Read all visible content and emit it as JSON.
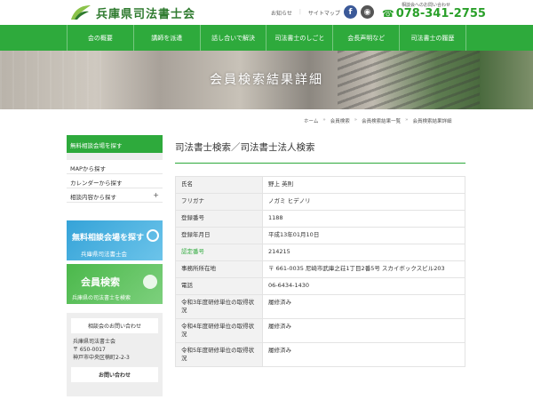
{
  "header": {
    "logo_text": "兵庫県司法書士会",
    "toplinks": [
      "お知らせ",
      "サイトマップ"
    ],
    "sns": [
      "f",
      "◉"
    ],
    "phone_note": "相談会へのお問い合わせ",
    "phone_number": "078-341-2755"
  },
  "nav": {
    "items": [
      "会の概要",
      "講師を派遣",
      "話し合いで解決",
      "司法書士のしごと",
      "会長声明など",
      "司法書士の履歴"
    ]
  },
  "hero": {
    "title": "会員検索結果詳細"
  },
  "breadcrumb": [
    "ホーム",
    "会員検索",
    "会員検索結果一覧",
    "会員検索結果詳細"
  ],
  "sidebar": {
    "head": "無料相談会場を探す",
    "items": [
      "MAPから探す",
      "カレンダーから探す",
      "相談内容から探す"
    ],
    "banner1": {
      "main": "無料相談会場を探す",
      "sub": "兵庫県司法書士会"
    },
    "banner2": {
      "main": "会員検索",
      "sub": "兵庫県の司法書士を検索"
    },
    "contact": {
      "title": "相談会のお問い合わせ",
      "lines": [
        "兵庫県司法書士会",
        "〒 650-0017",
        "神戸市中央区楠町2-2-3"
      ],
      "button": "お問い合わせ"
    }
  },
  "main": {
    "title": "司法書士検索／司法書士法人検索",
    "rows": [
      {
        "key": "氏名",
        "value": "野上 英則"
      },
      {
        "key": "フリガナ",
        "value": "ノガミ ヒデノリ"
      },
      {
        "key": "登録番号",
        "value": "1188"
      },
      {
        "key": "登録年月日",
        "value": "平成13年01月10日"
      },
      {
        "key": "認定番号",
        "value": "214215"
      },
      {
        "key": "事務所所在地",
        "value": "〒 661-0035 尼崎市武庫之荘1丁目2番5号 スカイボックスビル203"
      },
      {
        "key": "電話",
        "value": "06-6434-1430"
      },
      {
        "key": "令和3年度研修単位の取得状況",
        "value": "履修済み"
      },
      {
        "key": "令和4年度研修単位の取得状況",
        "value": "履修済み"
      },
      {
        "key": "令和5年度研修単位の取得状況",
        "value": "履修済み"
      }
    ]
  },
  "colors": {
    "brand_green": "#2eaa3c",
    "phone_green": "#2aa02a",
    "fb_blue": "#3b5998"
  }
}
